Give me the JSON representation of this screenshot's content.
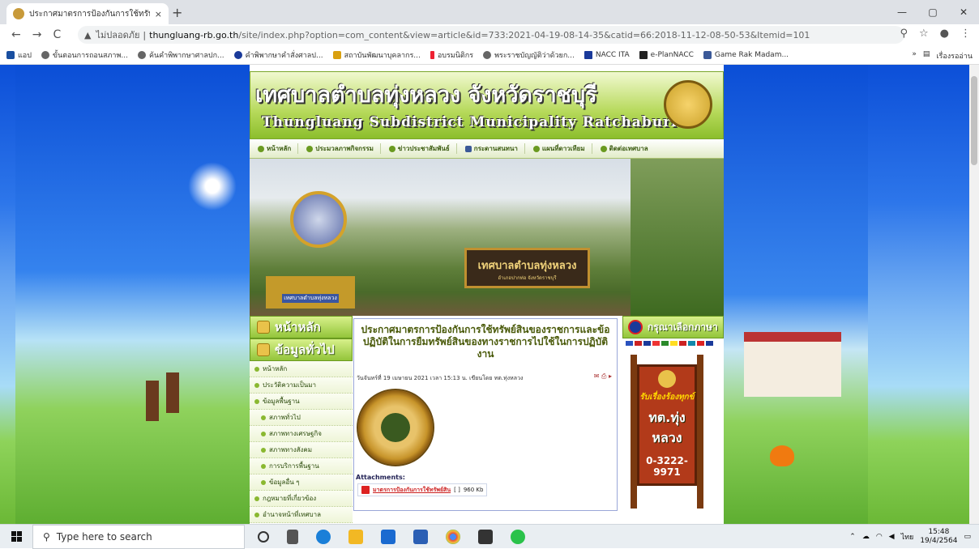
{
  "browser": {
    "tab_title": "ประกาศมาตรการป้องกันการใช้ทรัพย์สิ",
    "tab_close": "×",
    "new_tab": "+",
    "win_min": "—",
    "win_max": "▢",
    "win_close": "✕",
    "nav_back": "←",
    "nav_forward": "→",
    "nav_reload": "C",
    "security_label": "ไม่ปลอดภัย",
    "url_domain": "thungluang-rb.go.th",
    "url_path": "/site/index.php?option=com_content&view=article&id=733:2021-04-19-08-14-35&catid=66:2018-11-12-08-50-53&Itemid=101",
    "bookmarks": [
      "แอป",
      "ขั้นตอนการถอนสภาพ...",
      "ค้นคำพิพากษาศาลปก...",
      "คำพิพากษาคำสั่งศาลป...",
      "สถาบันพัฒนาบุคลากร...",
      "อบรมนิติกร",
      "พระราชบัญญัติว่าด้วยก...",
      "NACC ITA",
      "e-PlanNACC",
      "Game Rak Madam..."
    ],
    "reading_list": "เรื่องรออ่าน",
    "more_bookmarks": "»"
  },
  "site": {
    "title_th": "เทศบาลตำบลทุ่งหลวง จังหวัดราชบุรี",
    "title_en": "Thungluang Subdistrict Municipality Ratchaburi",
    "menu": [
      "หน้าหลัก",
      "ประมวลภาพกิจกรรม",
      "ข่าวประชาสัมพันธ์",
      "กระดานสนทนา",
      "แผนที่ดาวเทียม",
      "ติดต่อเทศบาล"
    ],
    "banner_sign": "เทศบาลตำบลทุ่งหลวง",
    "banner_sign_sub": "อำเภอปากท่อ  จังหวัดราชบุรี",
    "banner_pedestal": "เทศบาลตำบลทุ่งหลวง",
    "left_head1": "หน้าหลัก",
    "left_head2": "ข้อมูลทั่วไป",
    "left_items": [
      "หน้าหลัก",
      "ประวัติความเป็นมา",
      "ข้อมูลพื้นฐาน",
      "สภาพทั่วไป",
      "สภาพทางเศรษฐกิจ",
      "สภาพทางสังคม",
      "การบริการพื้นฐาน",
      "ข้อมูลอื่น ๆ",
      "กฎหมายที่เกี่ยวข้อง",
      "อำนาจหน้าที่เทศบาล"
    ],
    "right_head": "กรุณาเลือกภาษา",
    "sign_line1": "รับเรื่องร้องทุกข์",
    "sign_line2": "ทต.ทุ่งหลวง",
    "sign_line3": "0-3222-9971"
  },
  "article": {
    "title": "ประกาศมาตรการป้องกันการใช้ทรัพย์สินของราชการและข้อปฏิบัติในการยืมทรัพย์สินของทางราชการไปใช้ในการปฏิบัติงาน",
    "meta": "วันจันทร์ที่ 19 เมษายน 2021 เวลา 15:13 น. เขียนโดย ทต.ทุ่งหลวง",
    "attachments_label": "Attachments:",
    "file_name": "มาตรการป้องกันการใช้ทรัพย์สิน",
    "file_brackets": "[ ]",
    "file_size": "960 Kb"
  },
  "taskbar": {
    "search_placeholder": "Type here to search",
    "time": "15:48",
    "date": "19/4/2564",
    "lang": "ไทย"
  }
}
